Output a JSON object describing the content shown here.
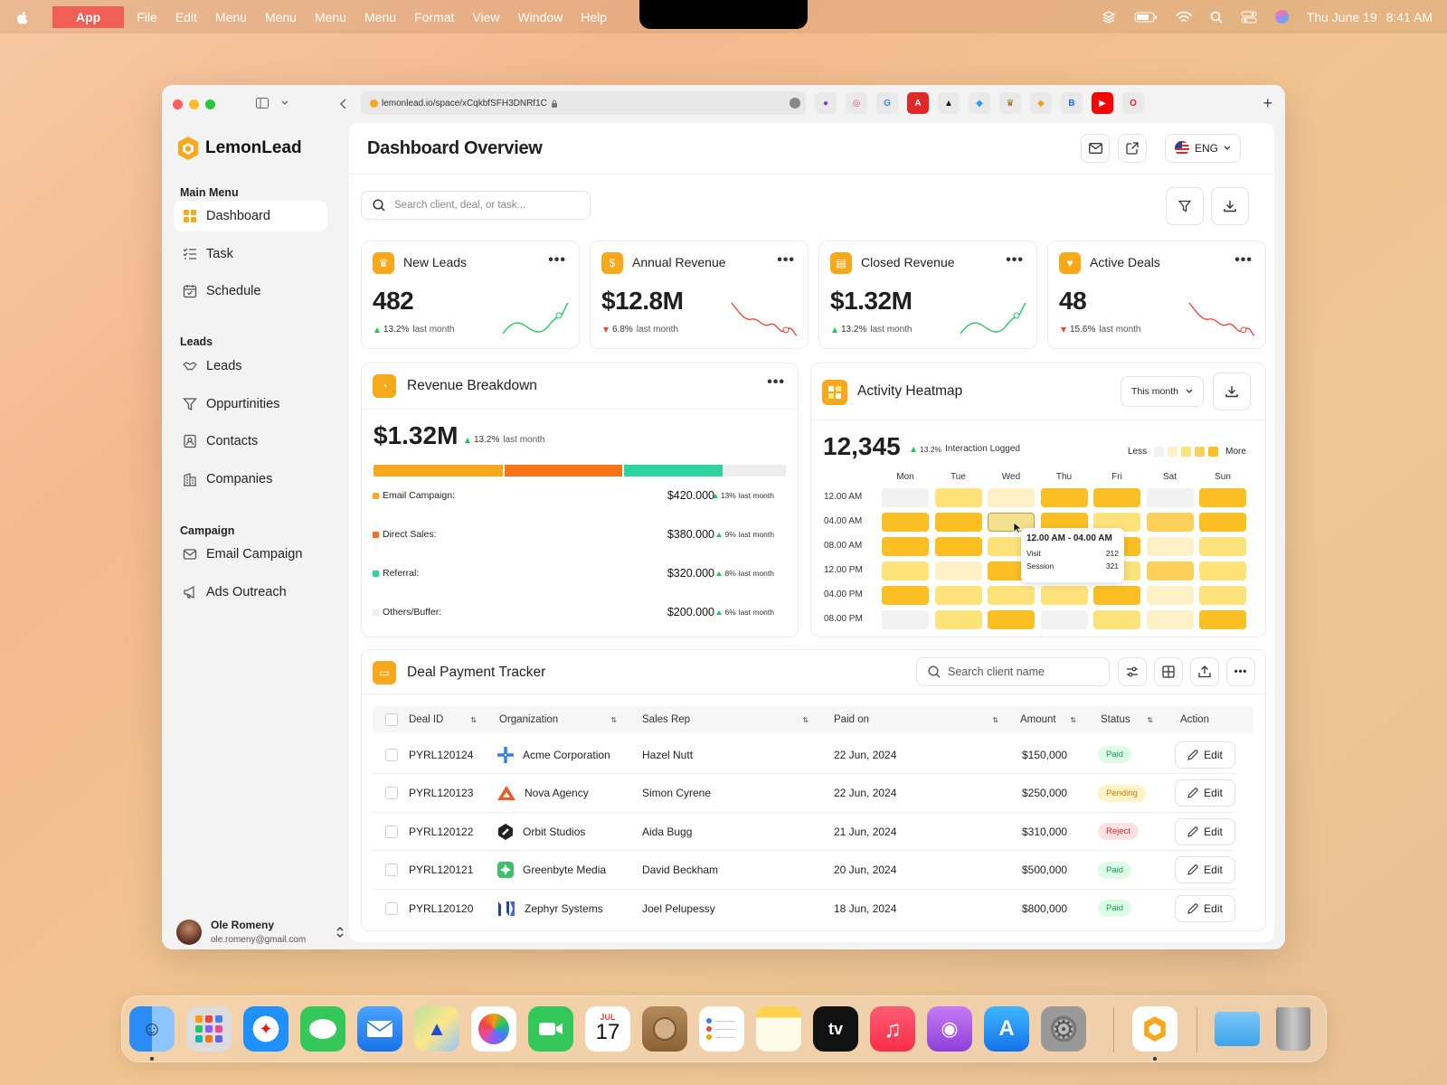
{
  "menubar": {
    "app": "App",
    "items": [
      "File",
      "Edit",
      "Menu",
      "Menu",
      "Menu",
      "Menu",
      "Format",
      "View",
      "Window",
      "Help"
    ],
    "date": "Thu June 19",
    "time": "8:41 AM"
  },
  "browser": {
    "url": "lemonlead.io/space/xCqkbfSFH3DNRf1C"
  },
  "sidebar": {
    "brand": "LemonLead",
    "main_menu_title": "Main Menu",
    "main_items": [
      {
        "label": "Dashboard",
        "icon": "grid-icon",
        "active": true
      },
      {
        "label": "Task",
        "icon": "checklist-icon"
      },
      {
        "label": "Schedule",
        "icon": "calendar-icon"
      }
    ],
    "leads_title": "Leads",
    "lead_items": [
      {
        "label": "Leads",
        "icon": "handshake-icon"
      },
      {
        "label": "Oppurtinities",
        "icon": "filter-icon"
      },
      {
        "label": "Contacts",
        "icon": "contact-icon"
      },
      {
        "label": "Companies",
        "icon": "building-icon"
      }
    ],
    "campaign_title": "Campaign",
    "campaign_items": [
      {
        "label": "Email Campaign",
        "icon": "mail-icon"
      },
      {
        "label": "Ads Outreach",
        "icon": "megaphone-icon"
      }
    ],
    "user": {
      "name": "Ole Romeny",
      "email": "ole.romeny@gmail.com"
    }
  },
  "header": {
    "title": "Dashboard Overview",
    "lang": "ENG"
  },
  "search": {
    "placeholder": "Search client, deal, or task..."
  },
  "kpis": [
    {
      "title": "New Leads",
      "value": "482",
      "delta": "13.2%",
      "dir": "up",
      "period": "last month"
    },
    {
      "title": "Annual Revenue",
      "value": "$12.8M",
      "delta": "6.8%",
      "dir": "down",
      "period": "last month"
    },
    {
      "title": "Closed Revenue",
      "value": "$1.32M",
      "delta": "13.2%",
      "dir": "up",
      "period": "last month"
    },
    {
      "title": "Active Deals",
      "value": "48",
      "delta": "15.6%",
      "dir": "down",
      "period": "last month"
    }
  ],
  "revenue": {
    "title": "Revenue Breakdown",
    "total": "$1.32M",
    "delta": "13.2%",
    "period": "last month",
    "items": [
      {
        "label": "Email Campaign:",
        "amount": "$420.000",
        "delta": "13%",
        "period": "last month",
        "color": "#f7a81b",
        "share": 420000
      },
      {
        "label": "Direct Sales:",
        "amount": "$380.000",
        "delta": "9%",
        "period": "last month",
        "color": "#f97316",
        "share": 380000
      },
      {
        "label": "Referral:",
        "amount": "$320.000",
        "delta": "8%",
        "period": "last month",
        "color": "#2dd4a0",
        "share": 320000
      },
      {
        "label": "Others/Buffer:",
        "amount": "$200.000",
        "delta": "6%",
        "period": "last month",
        "color": "#eeeeee",
        "share": 200000
      }
    ]
  },
  "heatmap": {
    "title": "Activity Heatmap",
    "period": "This month",
    "total": "12,345",
    "delta": "13.2%",
    "caption": "Interaction Logged",
    "less": "Less",
    "more": "More",
    "days": [
      "Mon",
      "Tue",
      "Wed",
      "Thu",
      "Fri",
      "Sat",
      "Sun"
    ],
    "times": [
      "12.00 AM",
      "04.00 AM",
      "08.00 AM",
      "12.00 PM",
      "04.00 PM",
      "08.00 PM"
    ],
    "levels": [
      [
        0,
        2,
        1,
        4,
        4,
        0,
        4
      ],
      [
        4,
        4,
        2,
        4,
        2,
        3,
        4
      ],
      [
        4,
        4,
        2,
        2,
        4,
        1,
        2
      ],
      [
        2,
        1,
        4,
        3,
        2,
        3,
        2
      ],
      [
        4,
        2,
        2,
        2,
        4,
        1,
        2
      ],
      [
        0,
        2,
        4,
        0,
        2,
        1,
        4
      ]
    ],
    "tooltip": {
      "range": "12.00 AM - 04.00 AM",
      "visit_label": "Visit",
      "visit": "212",
      "session_label": "Session",
      "session": "321"
    }
  },
  "tracker": {
    "title": "Deal Payment Tracker",
    "search_placeholder": "Search client name",
    "columns": [
      "Deal ID",
      "Organization",
      "Sales Rep",
      "Paid on",
      "Amount",
      "Status",
      "Action"
    ],
    "rows": [
      {
        "id": "PYRL120124",
        "org": "Acme Corporation",
        "rep": "Hazel Nutt",
        "paid": "22 Jun, 2024",
        "amount": "$150,000",
        "status": "Paid",
        "action": "Edit"
      },
      {
        "id": "PYRL120123",
        "org": "Nova Agency",
        "rep": "Simon Cyrene",
        "paid": "22 Jun, 2024",
        "amount": "$250,000",
        "status": "Pending",
        "action": "Edit"
      },
      {
        "id": "PYRL120122",
        "org": "Orbit Studios",
        "rep": "Aida Bugg",
        "paid": "21 Jun, 2024",
        "amount": "$310,000",
        "status": "Reject",
        "action": "Edit"
      },
      {
        "id": "PYRL120121",
        "org": "Greenbyte Media",
        "rep": "David Beckham",
        "paid": "20 Jun, 2024",
        "amount": "$500,000",
        "status": "Paid",
        "action": "Edit"
      },
      {
        "id": "PYRL120120",
        "org": "Zephyr Systems",
        "rep": "Joel Pelupessy",
        "paid": "18 Jun, 2024",
        "amount": "$800,000",
        "status": "Paid",
        "action": "Edit"
      }
    ]
  },
  "dock": {
    "calendar_month": "JUL",
    "calendar_day": "17",
    "tv_label": "tv"
  },
  "colors": {
    "accent": "#f7a81b",
    "paid": "#22c55e",
    "pending": "#f59e0b",
    "reject": "#ef4444"
  }
}
